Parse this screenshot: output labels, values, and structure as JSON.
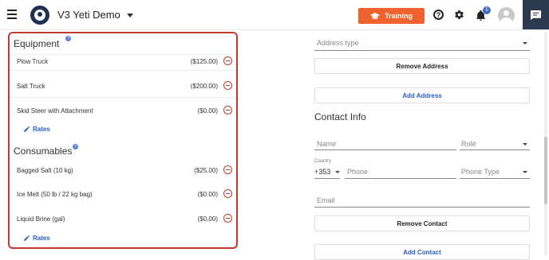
{
  "header": {
    "app_title": "V3 Yeti Demo",
    "training_label": "Training",
    "notification_count": "5",
    "help_glyph": "?"
  },
  "equipment": {
    "title": "Equipment",
    "info_glyph": "?",
    "items": [
      {
        "name": "Plow Truck",
        "price": "($125.00)"
      },
      {
        "name": "Salt Truck",
        "price": "($200.00)"
      },
      {
        "name": "Skid Steer with Attachment",
        "price": "($0.00)"
      }
    ],
    "rates_label": "Rates"
  },
  "consumables": {
    "title": "Consumables",
    "info_glyph": "?",
    "items": [
      {
        "name": "Bagged Salt (10 kg)",
        "price": "($25.00)"
      },
      {
        "name": "Ice Melt (50 lb / 22 kg bag)",
        "price": "($0.00)"
      },
      {
        "name": "Liquid Brine (gal)",
        "price": "($0.00)"
      }
    ],
    "rates_label": "Rates"
  },
  "address": {
    "type_placeholder": "Address type",
    "remove_label": "Remove Address",
    "add_label": "Add Address"
  },
  "contact": {
    "title": "Contact Info",
    "name_placeholder": "Name",
    "role_placeholder": "Role",
    "country_label": "Country",
    "country_code": "+353",
    "phone_placeholder": "Phone",
    "phone_type_placeholder": "Phone Type",
    "email_placeholder": "Email",
    "remove_label": "Remove Contact",
    "add_label": "Add Contact"
  },
  "colors": {
    "accent": "#f0622d",
    "link": "#2a5bc9",
    "danger": "#c0392b",
    "brand_dark": "#1f3150"
  }
}
